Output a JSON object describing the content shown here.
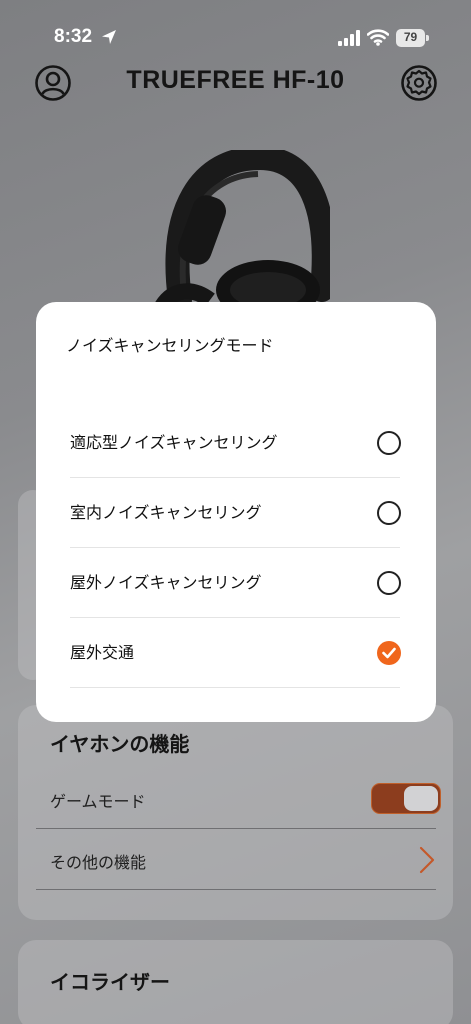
{
  "status_bar": {
    "time": "8:32",
    "battery": "79"
  },
  "header": {
    "title": "TRUEFREE HF-10"
  },
  "modal": {
    "title": "ノイズキャンセリングモード",
    "options": [
      {
        "label": "適応型ノイズキャンセリング",
        "selected": false
      },
      {
        "label": "室内ノイズキャンセリング",
        "selected": false
      },
      {
        "label": "屋外ノイズキャンセリング",
        "selected": false
      },
      {
        "label": "屋外交通",
        "selected": true
      }
    ]
  },
  "features": {
    "title": "イヤホンの機能",
    "game_mode_label": "ゲームモード",
    "game_mode_on": true,
    "other_label": "その他の機能"
  },
  "equalizer": {
    "title": "イコライザー"
  },
  "colors": {
    "accent": "#f0661c",
    "toggle_on": "#8c3d1e"
  }
}
